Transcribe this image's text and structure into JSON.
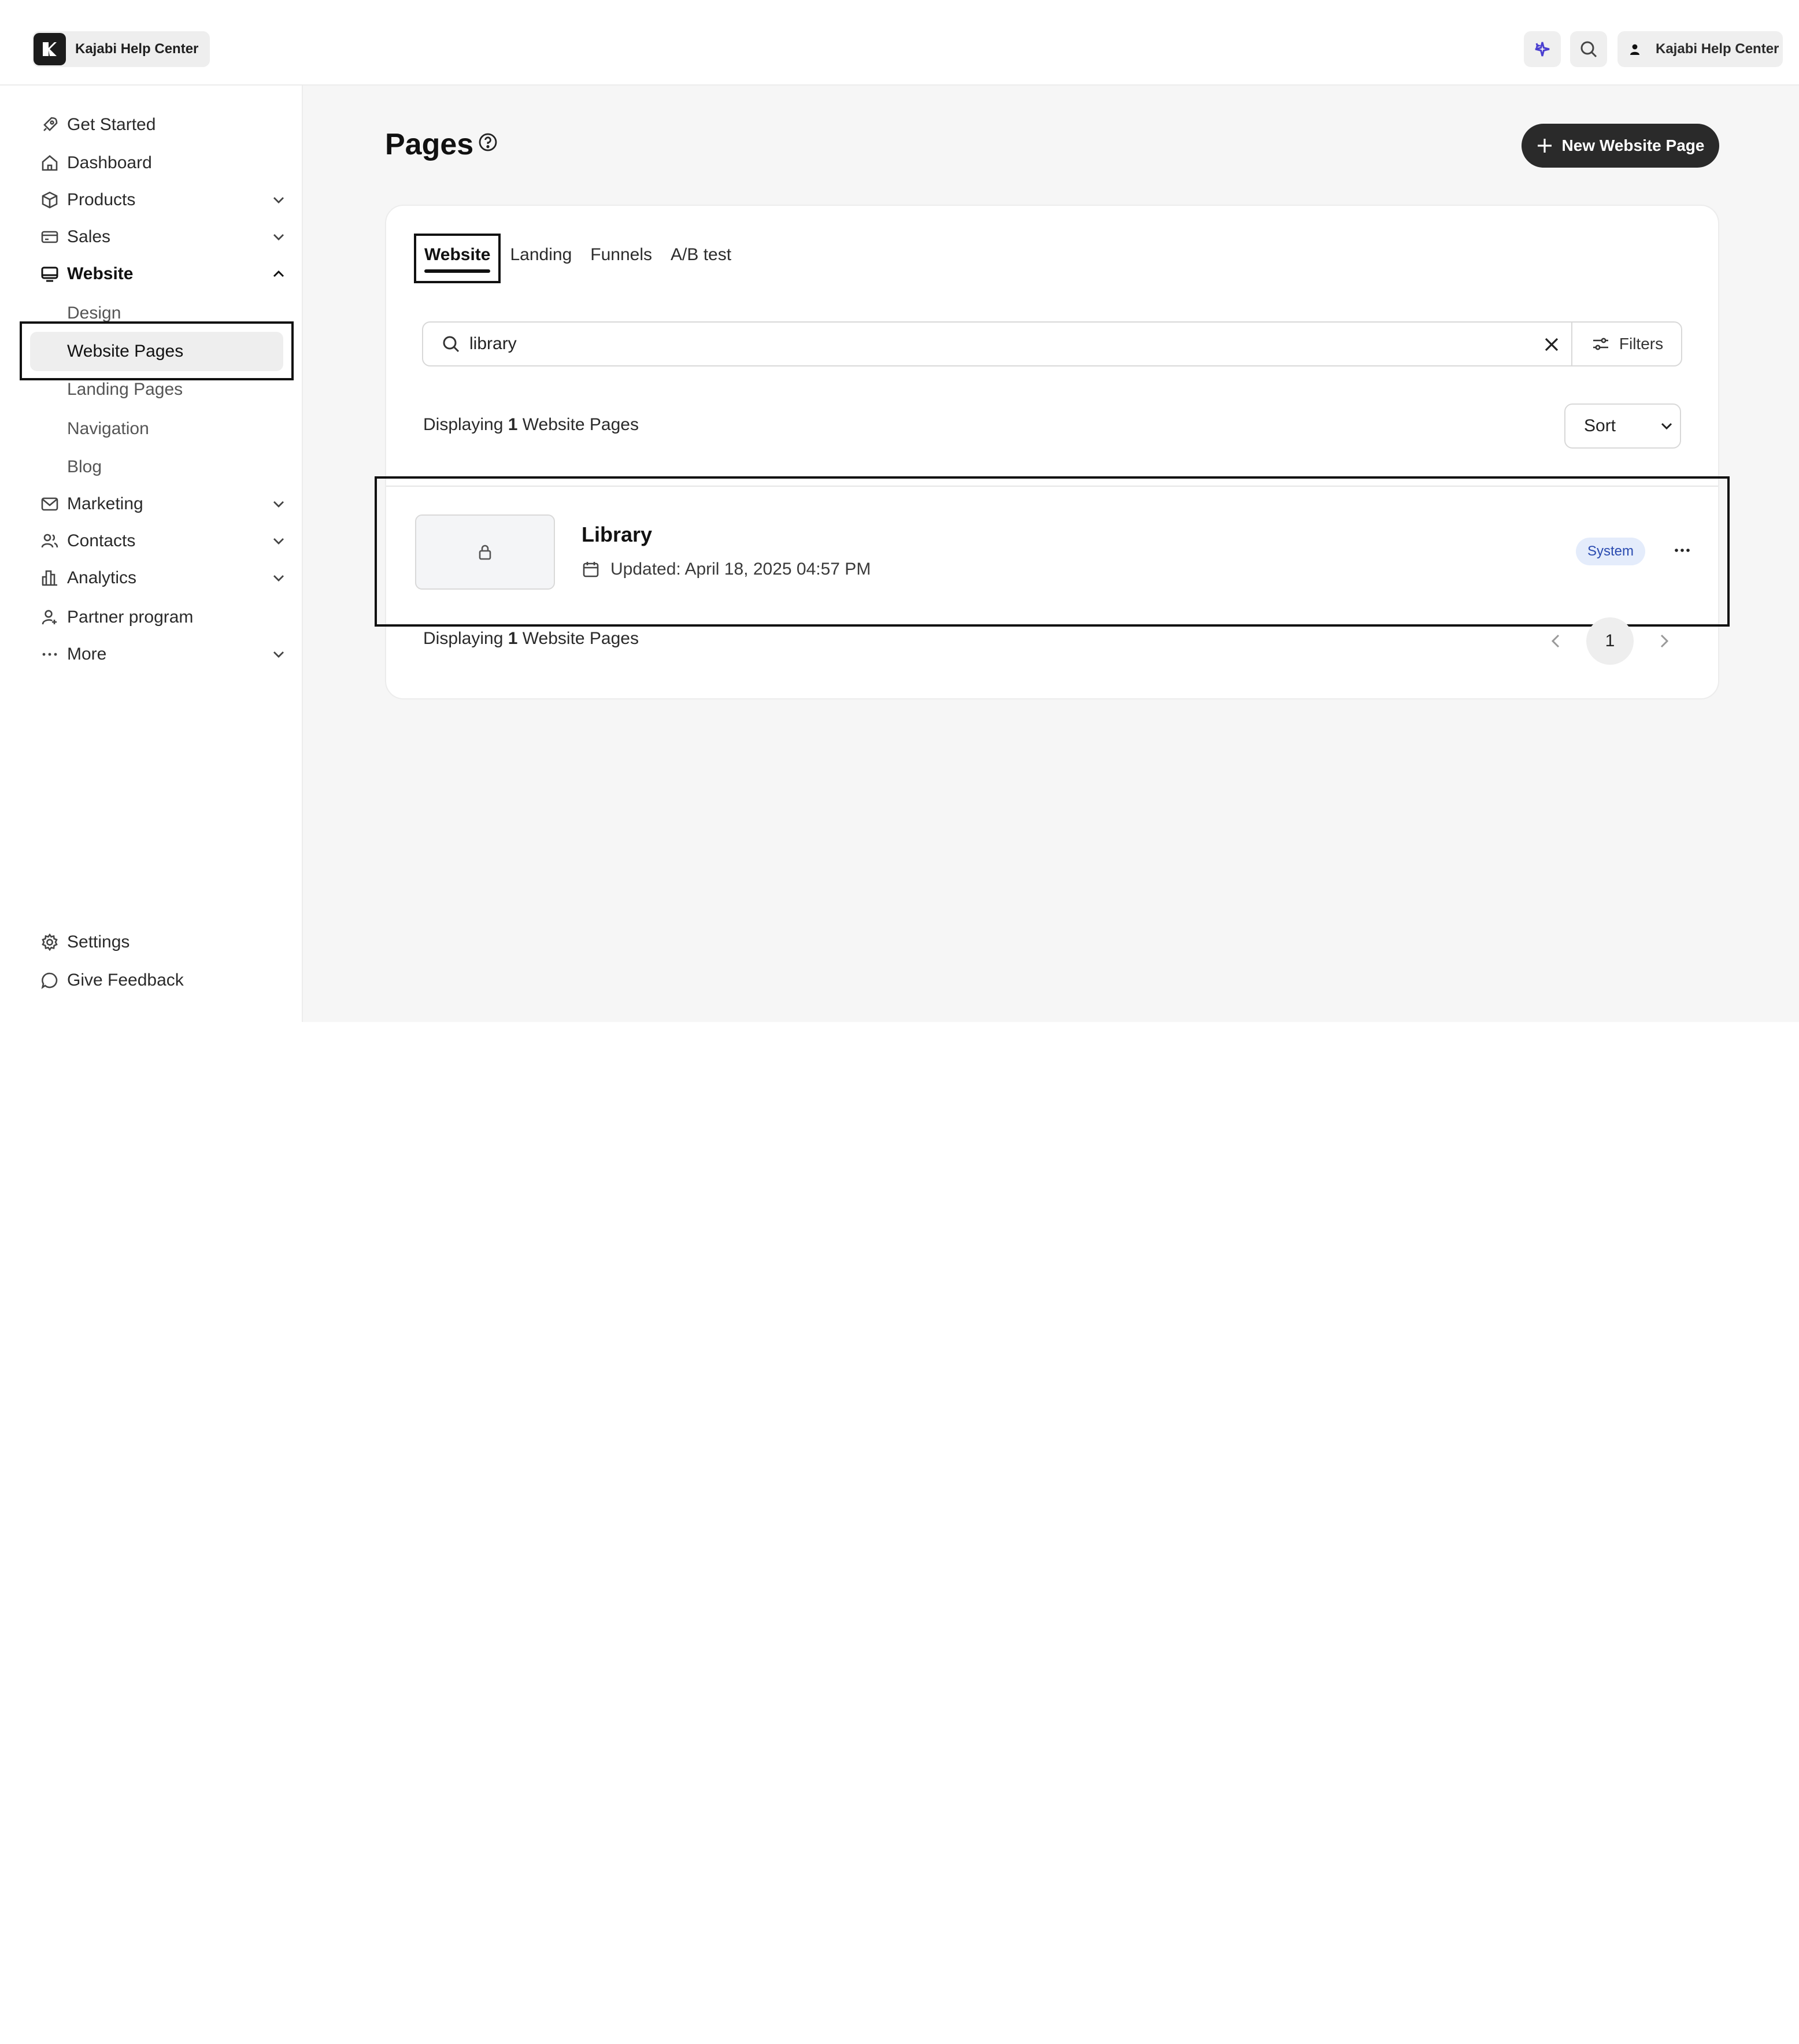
{
  "header": {
    "brand_name": "Kajabi Help Center",
    "ai_icon": "sparkle-icon",
    "search_icon": "search-icon",
    "account_name": "Kajabi Help Center"
  },
  "sidebar": {
    "items": [
      {
        "label": "Get Started",
        "icon": "rocket-icon"
      },
      {
        "label": "Dashboard",
        "icon": "home-icon"
      },
      {
        "label": "Products",
        "icon": "box-icon"
      },
      {
        "label": "Sales",
        "icon": "card-icon"
      },
      {
        "label": "Website",
        "icon": "monitor-icon"
      },
      {
        "label": "Marketing",
        "icon": "mail-icon"
      },
      {
        "label": "Contacts",
        "icon": "people-icon"
      },
      {
        "label": "Analytics",
        "icon": "chart-icon"
      },
      {
        "label": "Partner program",
        "icon": "partner-icon"
      },
      {
        "label": "More",
        "icon": "dots-icon"
      }
    ],
    "website_sub": [
      "Design",
      "Website Pages",
      "Landing Pages",
      "Navigation",
      "Blog"
    ],
    "footer": [
      {
        "label": "Settings",
        "icon": "gear-icon"
      },
      {
        "label": "Give Feedback",
        "icon": "chat-icon"
      }
    ]
  },
  "main": {
    "title": "Pages",
    "new_button": "New Website Page",
    "tabs": [
      "Website",
      "Landing",
      "Funnels",
      "A/B test"
    ],
    "search": {
      "value": "library",
      "filters_label": "Filters"
    },
    "count": {
      "prefix": "Displaying ",
      "number": "1",
      "suffix": " Website Pages"
    },
    "sort_label": "Sort",
    "rows": [
      {
        "title": "Library",
        "updated": "Updated: April 18, 2025 04:57 PM",
        "badge": "System"
      }
    ],
    "pagination": {
      "current": "1"
    }
  }
}
